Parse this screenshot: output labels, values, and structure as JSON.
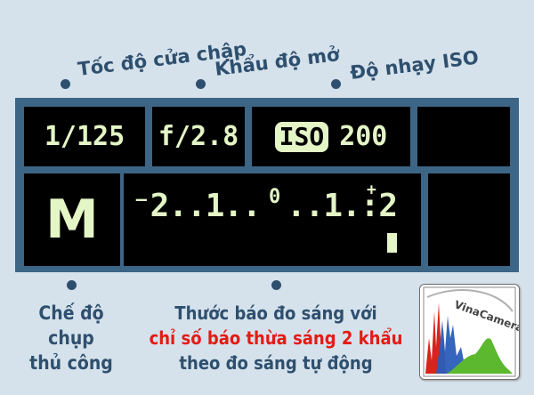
{
  "top_labels": {
    "shutter": "Tốc độ cửa chập",
    "aperture": "Khẩu độ mở",
    "iso": "Độ nhạy ISO"
  },
  "display": {
    "shutter_value": "1/125",
    "aperture_value": "f/2.8",
    "iso_badge": "ISO",
    "iso_value": "200",
    "mode": "M",
    "meter_left": "⁻2..1..",
    "meter_zero": "0",
    "meter_right": "..1.:2",
    "meter_plus": "+",
    "exposure_level_stops": 2
  },
  "captions": {
    "mode": [
      "Chế độ",
      "chụp",
      "thủ công"
    ],
    "meter": {
      "line1": "Thước báo đo sáng với",
      "line2_red": "chỉ số báo thừa sáng 2 khẩu",
      "line3": "theo đo sáng tự động"
    }
  },
  "logo": {
    "text": "VinaCamera.com",
    "colors": {
      "red": "#d9231c",
      "blue": "#2a5db8",
      "green": "#5cb82e",
      "frame": "#6f6f6f"
    }
  },
  "colors": {
    "background": "#d5e2ec",
    "panel": "#3d6585",
    "lcd_text": "#e4f5c6",
    "label": "#2f4f6e",
    "highlight": "#e31b14"
  }
}
